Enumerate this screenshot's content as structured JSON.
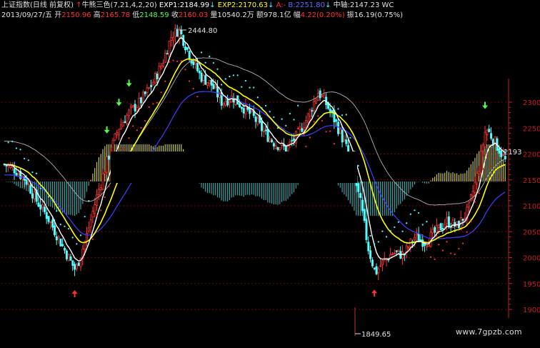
{
  "header": {
    "title": "上证指数(日线 前复权)",
    "indicator_name": "牛熊三色(7,21,4,2,20)",
    "exp1_label": "EXP1:",
    "exp1_value": "2184.99",
    "exp2_label": "EXP2:",
    "exp2_value": "2170.63",
    "a_label": "A:",
    "b_label": "B:",
    "b_value": "2251.80",
    "mid_label": "中轴:",
    "mid_value": "2147.23",
    "tail": "WC",
    "date": "2013/09/27/五",
    "open_label": "开",
    "open_value": "2150.96",
    "high_label": "高",
    "high_value": "2165.78",
    "low_label": "低",
    "low_value": "2148.59",
    "close_label": "收",
    "close_value": "2160.03",
    "vol_label": "量",
    "vol_value": "10540.2万",
    "amt_label": "额",
    "amt_value": "978.1亿",
    "chg_label": "幅",
    "chg_value": "4.22(0.20%)",
    "amp_label": "振",
    "amp_value": "16.19(0.75%)"
  },
  "colors": {
    "background": "#000000",
    "up": "#ff3232",
    "down": "#54fcfc",
    "exp1": "#ffffff",
    "exp2": "#ffff00",
    "band": "#4040ff",
    "grid": "#7a0000",
    "axis": "#c81e1e",
    "macd_up": "#c8c850",
    "macd_down": "#40a0a0",
    "sar": "#54fcfc",
    "sar_up": "#ff3232"
  },
  "watermark": "www.7gpzb.com",
  "chart_data": {
    "type": "candlestick",
    "ylim": [
      1880,
      2460
    ],
    "y_ticks": [
      1900,
      1950,
      2000,
      2050,
      2100,
      2150,
      2200,
      2250,
      2300
    ],
    "annotations": {
      "high": "2444.80",
      "low": "1849.65",
      "last": "2193"
    },
    "overlay_series": [
      "EXP1",
      "EXP2",
      "A",
      "B",
      "中轴",
      "SAR",
      "MACD"
    ]
  }
}
